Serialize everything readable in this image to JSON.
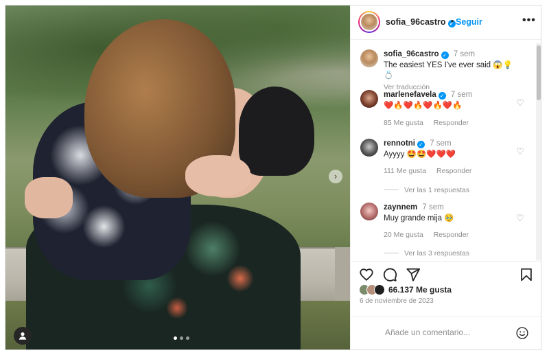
{
  "post": {
    "carousel": {
      "total": 3,
      "active": 1
    }
  },
  "header": {
    "username": "sofia_96castro",
    "dot": "•",
    "follow_label": "Seguir",
    "more_label": "•••"
  },
  "caption": {
    "username": "sofia_96castro",
    "time": "7 sem",
    "text": "The easiest YES I've ever said 😱💡💍",
    "translate_label": "Ver traducción"
  },
  "comments": [
    {
      "username": "marlenefavela",
      "verified": true,
      "time": "7 sem",
      "text": "❤️🔥❤️🔥❤️🔥❤️🔥",
      "likes": "85 Me gusta",
      "reply_label": "Responder"
    },
    {
      "username": "rennotni",
      "verified": true,
      "time": "7 sem",
      "text": "Ayyyy 🤩🤩❤️❤️❤️",
      "likes": "111 Me gusta",
      "reply_label": "Responder",
      "view_replies": "Ver las 1 respuestas"
    },
    {
      "username": "zaynnem",
      "verified": false,
      "time": "7 sem",
      "text": "Muy grande mija 🥹",
      "likes": "20 Me gusta",
      "reply_label": "Responder",
      "view_replies": "Ver las 3 respuestas"
    }
  ],
  "footer": {
    "likes_count": "66.137 Me gusta",
    "date": "6 de noviembre de 2023",
    "comment_placeholder": "Añade un comentario..."
  },
  "icons": {
    "like": "heart-icon",
    "comment": "comment-icon",
    "share": "send-icon",
    "save": "bookmark-icon",
    "emoji": "smiley-icon",
    "next": "chevron-right-icon",
    "tag": "user-tag-icon",
    "more": "more-options-icon"
  },
  "colors": {
    "accent": "#0095f6",
    "text": "#262626",
    "muted": "#8e8e8e",
    "border": "#efefef"
  }
}
